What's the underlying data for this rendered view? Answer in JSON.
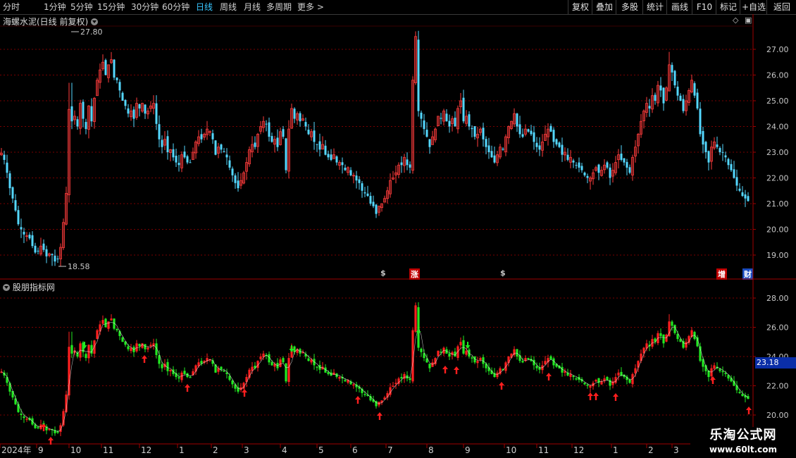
{
  "toolbar": {
    "periods": [
      "分时",
      "1分钟",
      "5分钟",
      "15分钟",
      "30分钟",
      "60分钟",
      "日线",
      "周线",
      "月线",
      "多周期",
      "更多"
    ],
    "active_period": "日线",
    "more_arrow": ">",
    "buttons": [
      "复权",
      "叠加",
      "多股",
      "统计",
      "画线",
      "F10",
      "标记",
      "+自选",
      "返回"
    ]
  },
  "main_chart": {
    "title": "海螺水泥(日线 前复权)",
    "high_label": "27.80",
    "low_label": "18.58",
    "y_ticks": [
      "27.00",
      "26.00",
      "25.00",
      "24.00",
      "23.00",
      "22.00",
      "21.00",
      "20.00",
      "19.00"
    ],
    "markers": [
      {
        "text": "$",
        "color": "#ff3030"
      },
      {
        "text": "涨",
        "color": "#ffffff",
        "bg": "#c00000"
      },
      {
        "text": "$",
        "color": "#ff3030"
      },
      {
        "text": "增",
        "color": "#ffffff",
        "bg": "#c00000"
      },
      {
        "text": "财",
        "color": "#ffffff",
        "bg": "#1a4cc0"
      }
    ]
  },
  "sub_chart": {
    "title": "股朋指标网",
    "y_ticks": [
      "28.00",
      "26.00",
      "24.00",
      "22.00",
      "20.00"
    ],
    "current_price": "23.18"
  },
  "date_axis": [
    "2024年",
    "9",
    "10",
    "11",
    "12",
    "1",
    "2",
    "3",
    "4",
    "5",
    "6",
    "7",
    "8",
    "9",
    "10",
    "11",
    "12",
    "1",
    "2",
    "3"
  ],
  "watermark": {
    "line1": "乐淘公式网",
    "line2": "www.60lt.com"
  },
  "colors": {
    "up": "#ff3c3c",
    "down": "#54d8ff",
    "sub_up": "#ff2020",
    "sub_down": "#22e822",
    "grid": "#7a0000",
    "ma": "#ffffff",
    "arrow": "#ff1e1e"
  },
  "chart_data": {
    "type": "candlestick",
    "title": "海螺水泥(日线 前复权)",
    "x_labels": [
      "2024年",
      "9",
      "10",
      "11",
      "12",
      "1",
      "2",
      "3",
      "4",
      "5",
      "6",
      "7",
      "8",
      "9",
      "10",
      "11",
      "12",
      "1",
      "2",
      "3"
    ],
    "y_range": [
      18.3,
      27.9
    ],
    "close_path": [
      [
        0,
        22.9
      ],
      [
        3,
        23.0
      ],
      [
        8,
        22.5
      ],
      [
        14,
        21.6
      ],
      [
        20,
        21.0
      ],
      [
        26,
        20.2
      ],
      [
        30,
        20.0
      ],
      [
        36,
        19.7
      ],
      [
        40,
        19.8
      ],
      [
        44,
        19.5
      ],
      [
        48,
        19.2
      ],
      [
        52,
        19.0
      ],
      [
        56,
        19.3
      ],
      [
        60,
        19.4
      ],
      [
        64,
        19.0
      ],
      [
        68,
        18.9
      ],
      [
        72,
        19.2
      ],
      [
        76,
        18.8
      ],
      [
        80,
        18.7
      ],
      [
        84,
        19.0
      ],
      [
        88,
        19.6
      ],
      [
        91,
        20.6
      ],
      [
        94,
        21.4
      ],
      [
        97,
        24.2
      ],
      [
        100,
        25.6
      ],
      [
        103,
        23.5
      ],
      [
        106,
        24.4
      ],
      [
        110,
        24.0
      ],
      [
        114,
        24.9
      ],
      [
        118,
        24.3
      ],
      [
        122,
        23.9
      ],
      [
        126,
        24.8
      ],
      [
        130,
        24.2
      ],
      [
        134,
        25.1
      ],
      [
        138,
        25.8
      ],
      [
        142,
        26.2
      ],
      [
        146,
        26.5
      ],
      [
        150,
        26.0
      ],
      [
        154,
        26.4
      ],
      [
        158,
        26.6
      ],
      [
        162,
        25.9
      ],
      [
        166,
        25.8
      ],
      [
        170,
        25.4
      ],
      [
        174,
        25.0
      ],
      [
        178,
        24.8
      ],
      [
        182,
        24.5
      ],
      [
        186,
        24.6
      ],
      [
        190,
        24.3
      ],
      [
        194,
        24.9
      ],
      [
        198,
        24.7
      ],
      [
        202,
        24.9
      ],
      [
        206,
        24.5
      ],
      [
        210,
        24.6
      ],
      [
        214,
        24.8
      ],
      [
        218,
        24.9
      ],
      [
        222,
        24.1
      ],
      [
        226,
        23.5
      ],
      [
        230,
        23.2
      ],
      [
        234,
        23.5
      ],
      [
        238,
        23.0
      ],
      [
        242,
        23.1
      ],
      [
        246,
        22.8
      ],
      [
        250,
        22.6
      ],
      [
        254,
        22.5
      ],
      [
        258,
        22.9
      ],
      [
        262,
        22.8
      ],
      [
        266,
        22.6
      ],
      [
        270,
        22.6
      ],
      [
        274,
        23.0
      ],
      [
        278,
        23.4
      ],
      [
        282,
        23.6
      ],
      [
        286,
        23.5
      ],
      [
        290,
        23.7
      ],
      [
        294,
        23.9
      ],
      [
        298,
        23.8
      ],
      [
        302,
        23.5
      ],
      [
        306,
        22.9
      ],
      [
        310,
        23.2
      ],
      [
        314,
        23.1
      ],
      [
        318,
        23.0
      ],
      [
        322,
        22.8
      ],
      [
        326,
        22.4
      ],
      [
        330,
        22.1
      ],
      [
        334,
        21.8
      ],
      [
        338,
        21.6
      ],
      [
        342,
        21.9
      ],
      [
        346,
        22.2
      ],
      [
        350,
        22.6
      ],
      [
        354,
        23.1
      ],
      [
        358,
        23.3
      ],
      [
        362,
        23.2
      ],
      [
        366,
        23.7
      ],
      [
        370,
        24.0
      ],
      [
        374,
        24.2
      ],
      [
        378,
        24.1
      ],
      [
        382,
        23.6
      ],
      [
        386,
        23.4
      ],
      [
        390,
        23.5
      ],
      [
        394,
        23.2
      ],
      [
        398,
        23.8
      ],
      [
        402,
        23.6
      ],
      [
        406,
        22.3
      ],
      [
        410,
        23.9
      ],
      [
        414,
        24.7
      ],
      [
        418,
        24.3
      ],
      [
        422,
        24.5
      ],
      [
        426,
        24.2
      ],
      [
        430,
        24.3
      ],
      [
        434,
        24.0
      ],
      [
        438,
        23.7
      ],
      [
        442,
        23.8
      ],
      [
        446,
        23.4
      ],
      [
        450,
        23.3
      ],
      [
        454,
        23.1
      ],
      [
        458,
        23.3
      ],
      [
        462,
        22.9
      ],
      [
        466,
        22.8
      ],
      [
        470,
        22.7
      ],
      [
        474,
        22.9
      ],
      [
        478,
        22.6
      ],
      [
        482,
        22.6
      ],
      [
        486,
        22.5
      ],
      [
        490,
        22.3
      ],
      [
        494,
        22.4
      ],
      [
        498,
        22.1
      ],
      [
        502,
        22.1
      ],
      [
        506,
        21.9
      ],
      [
        510,
        21.8
      ],
      [
        514,
        21.5
      ],
      [
        518,
        21.4
      ],
      [
        522,
        21.3
      ],
      [
        526,
        21.0
      ],
      [
        530,
        20.9
      ],
      [
        534,
        20.6
      ],
      [
        538,
        20.9
      ],
      [
        542,
        21.0
      ],
      [
        546,
        21.2
      ],
      [
        550,
        21.5
      ],
      [
        554,
        21.9
      ],
      [
        558,
        22.0
      ],
      [
        562,
        22.2
      ],
      [
        566,
        22.5
      ],
      [
        570,
        22.5
      ],
      [
        574,
        22.8
      ],
      [
        578,
        22.5
      ],
      [
        582,
        22.4
      ],
      [
        586,
        25.8
      ],
      [
        590,
        27.5
      ],
      [
        594,
        24.6
      ],
      [
        598,
        24.3
      ],
      [
        602,
        23.9
      ],
      [
        606,
        23.6
      ],
      [
        610,
        23.2
      ],
      [
        614,
        23.6
      ],
      [
        618,
        23.9
      ],
      [
        622,
        24.4
      ],
      [
        626,
        24.3
      ],
      [
        630,
        24.6
      ],
      [
        634,
        24.2
      ],
      [
        638,
        24.0
      ],
      [
        642,
        24.3
      ],
      [
        646,
        24.0
      ],
      [
        650,
        24.7
      ],
      [
        654,
        25.0
      ],
      [
        658,
        24.2
      ],
      [
        662,
        24.4
      ],
      [
        666,
        24.0
      ],
      [
        670,
        23.9
      ],
      [
        674,
        23.6
      ],
      [
        678,
        23.7
      ],
      [
        682,
        23.9
      ],
      [
        686,
        23.5
      ],
      [
        690,
        23.2
      ],
      [
        694,
        23.0
      ],
      [
        698,
        22.8
      ],
      [
        702,
        22.6
      ],
      [
        706,
        22.9
      ],
      [
        710,
        23.2
      ],
      [
        714,
        23.1
      ],
      [
        718,
        23.6
      ],
      [
        722,
        24.0
      ],
      [
        726,
        24.2
      ],
      [
        730,
        24.5
      ],
      [
        734,
        24.0
      ],
      [
        738,
        23.7
      ],
      [
        742,
        23.6
      ],
      [
        746,
        23.9
      ],
      [
        750,
        23.8
      ],
      [
        754,
        23.7
      ],
      [
        758,
        23.4
      ],
      [
        762,
        23.2
      ],
      [
        766,
        23.1
      ],
      [
        770,
        23.4
      ],
      [
        774,
        23.7
      ],
      [
        778,
        23.9
      ],
      [
        782,
        23.8
      ],
      [
        786,
        23.4
      ],
      [
        790,
        23.3
      ],
      [
        794,
        23.2
      ],
      [
        798,
        22.9
      ],
      [
        802,
        23.0
      ],
      [
        806,
        22.7
      ],
      [
        810,
        22.8
      ],
      [
        814,
        22.6
      ],
      [
        818,
        22.5
      ],
      [
        822,
        22.4
      ],
      [
        826,
        22.3
      ],
      [
        830,
        22.1
      ],
      [
        834,
        22.0
      ],
      [
        838,
        22.0
      ],
      [
        842,
        22.2
      ],
      [
        846,
        22.4
      ],
      [
        850,
        22.2
      ],
      [
        854,
        22.3
      ],
      [
        858,
        22.5
      ],
      [
        862,
        22.4
      ],
      [
        866,
        22.0
      ],
      [
        870,
        22.3
      ],
      [
        874,
        22.6
      ],
      [
        878,
        22.9
      ],
      [
        882,
        22.7
      ],
      [
        886,
        22.6
      ],
      [
        890,
        22.4
      ],
      [
        894,
        22.2
      ],
      [
        898,
        22.8
      ],
      [
        902,
        23.2
      ],
      [
        906,
        23.7
      ],
      [
        910,
        24.2
      ],
      [
        914,
        24.6
      ],
      [
        918,
        24.9
      ],
      [
        922,
        24.7
      ],
      [
        926,
        25.2
      ],
      [
        930,
        25.0
      ],
      [
        934,
        25.6
      ],
      [
        938,
        25.4
      ],
      [
        942,
        24.9
      ],
      [
        946,
        25.5
      ],
      [
        950,
        26.4
      ],
      [
        954,
        26.1
      ],
      [
        958,
        25.6
      ],
      [
        962,
        25.2
      ],
      [
        966,
        25.0
      ],
      [
        970,
        24.6
      ],
      [
        974,
        25.0
      ],
      [
        978,
        25.4
      ],
      [
        982,
        25.8
      ],
      [
        986,
        25.2
      ],
      [
        990,
        24.7
      ],
      [
        994,
        23.7
      ],
      [
        998,
        23.3
      ],
      [
        1002,
        23.0
      ],
      [
        1006,
        22.6
      ],
      [
        1010,
        23.2
      ],
      [
        1014,
        23.4
      ],
      [
        1018,
        23.2
      ],
      [
        1022,
        23.0
      ],
      [
        1026,
        23.0
      ],
      [
        1030,
        22.8
      ],
      [
        1034,
        22.5
      ],
      [
        1038,
        22.3
      ],
      [
        1042,
        22.0
      ],
      [
        1046,
        21.7
      ],
      [
        1050,
        21.5
      ],
      [
        1054,
        21.3
      ],
      [
        1058,
        21.2
      ],
      [
        1062,
        21.1
      ]
    ]
  }
}
